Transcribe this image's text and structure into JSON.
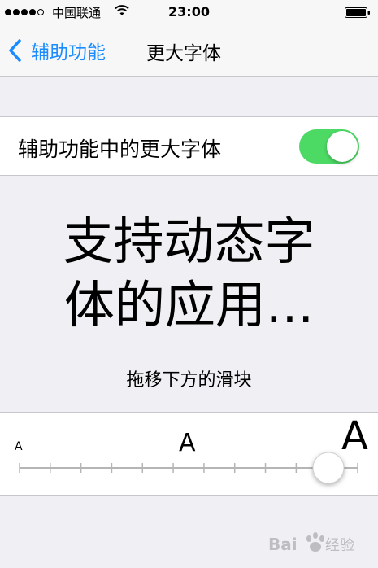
{
  "status_bar": {
    "carrier": "中国联通",
    "time": "23:00",
    "signal_bars": 5,
    "signal_filled": 4
  },
  "nav_bar": {
    "back_label": "辅助功能",
    "title": "更大字体"
  },
  "toggle": {
    "label": "辅助功能中的更大字体",
    "state": "on",
    "on_color": "#4cd964"
  },
  "preview": {
    "line1": "支持动态字",
    "line2": "体的应用...",
    "hint": "拖移下方的滑块"
  },
  "slider": {
    "small_label": "A",
    "medium_label": "A",
    "large_label": "A",
    "tick_count": 12,
    "selected_index": 11
  },
  "watermark": {
    "text": "Baidu经验"
  },
  "colors": {
    "accent": "#1a8cff",
    "background": "#efeff4",
    "separator": "#c8c7cc"
  }
}
